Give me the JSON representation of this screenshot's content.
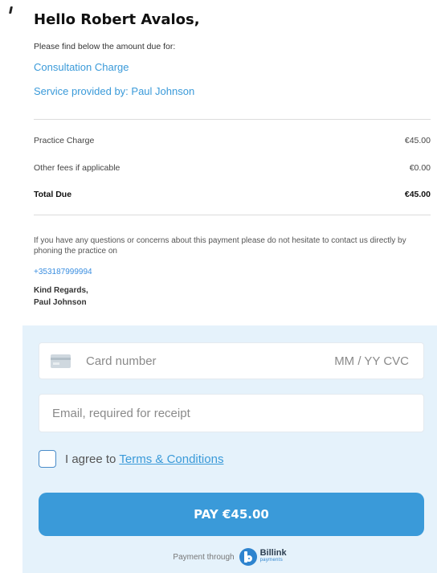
{
  "invoice": {
    "greeting": "Hello Robert Avalos,",
    "intro": "Please find below the amount due for:",
    "service_name": "Consultation Charge",
    "provider": "Service provided by: Paul Johnson",
    "fees": [
      {
        "label": "Practice Charge",
        "amount": "€45.00"
      },
      {
        "label": "Other fees if applicable",
        "amount": "€0.00"
      },
      {
        "label": "Total Due",
        "amount": "€45.00"
      }
    ],
    "note": "If you have any questions or concerns about this payment please do not hesitate to contact us directly by phoning the practice on",
    "phone": "+353187999994",
    "regards": "Kind Regards,",
    "signature": "Paul Johnson"
  },
  "payment": {
    "card_placeholder": "Card number",
    "card_extra": "MM / YY  CVC",
    "email_placeholder": "Email, required for receipt",
    "agree_prefix": "I agree to",
    "terms_label": "Terms & Conditions",
    "pay_label": "PAY €45.00",
    "footer_prefix": "Payment through",
    "brand_name": "Billink",
    "brand_sub": "payments"
  },
  "colors": {
    "accent": "#3a9ad9",
    "panel_bg": "#e5f2fb",
    "brand": "#2e84cf"
  },
  "icons": {
    "card": "credit-card-icon",
    "brand": "billink-logo-icon"
  }
}
